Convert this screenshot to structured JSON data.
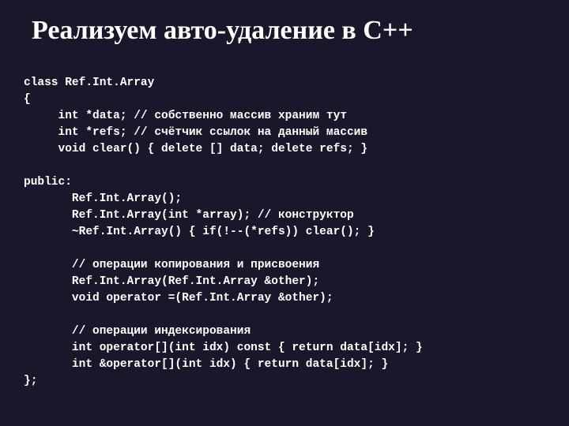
{
  "title": "Реализуем авто-удаление в C++",
  "code": {
    "l01": "class Ref.Int.Array",
    "l02": "{",
    "l03": "     int *data; // собственно массив храним тут",
    "l04": "     int *refs; // счётчик ссылок на данный массив",
    "l05": "     void clear() { delete [] data; delete refs; }",
    "l06": "",
    "l07": "public:",
    "l08": "       Ref.Int.Array();",
    "l09": "       Ref.Int.Array(int *array); // конструктор",
    "l10": "       ~Ref.Int.Array() { if(!--(*refs)) clear(); }",
    "l11": "",
    "l12": "       // операции копирования и присвоения",
    "l13": "       Ref.Int.Array(Ref.Int.Array &other);",
    "l14": "       void operator =(Ref.Int.Array &other);",
    "l15": "",
    "l16": "       // операции индексирования",
    "l17": "       int operator[](int idx) const { return data[idx]; }",
    "l18": "       int &operator[](int idx) { return data[idx]; }",
    "l19": "};"
  }
}
